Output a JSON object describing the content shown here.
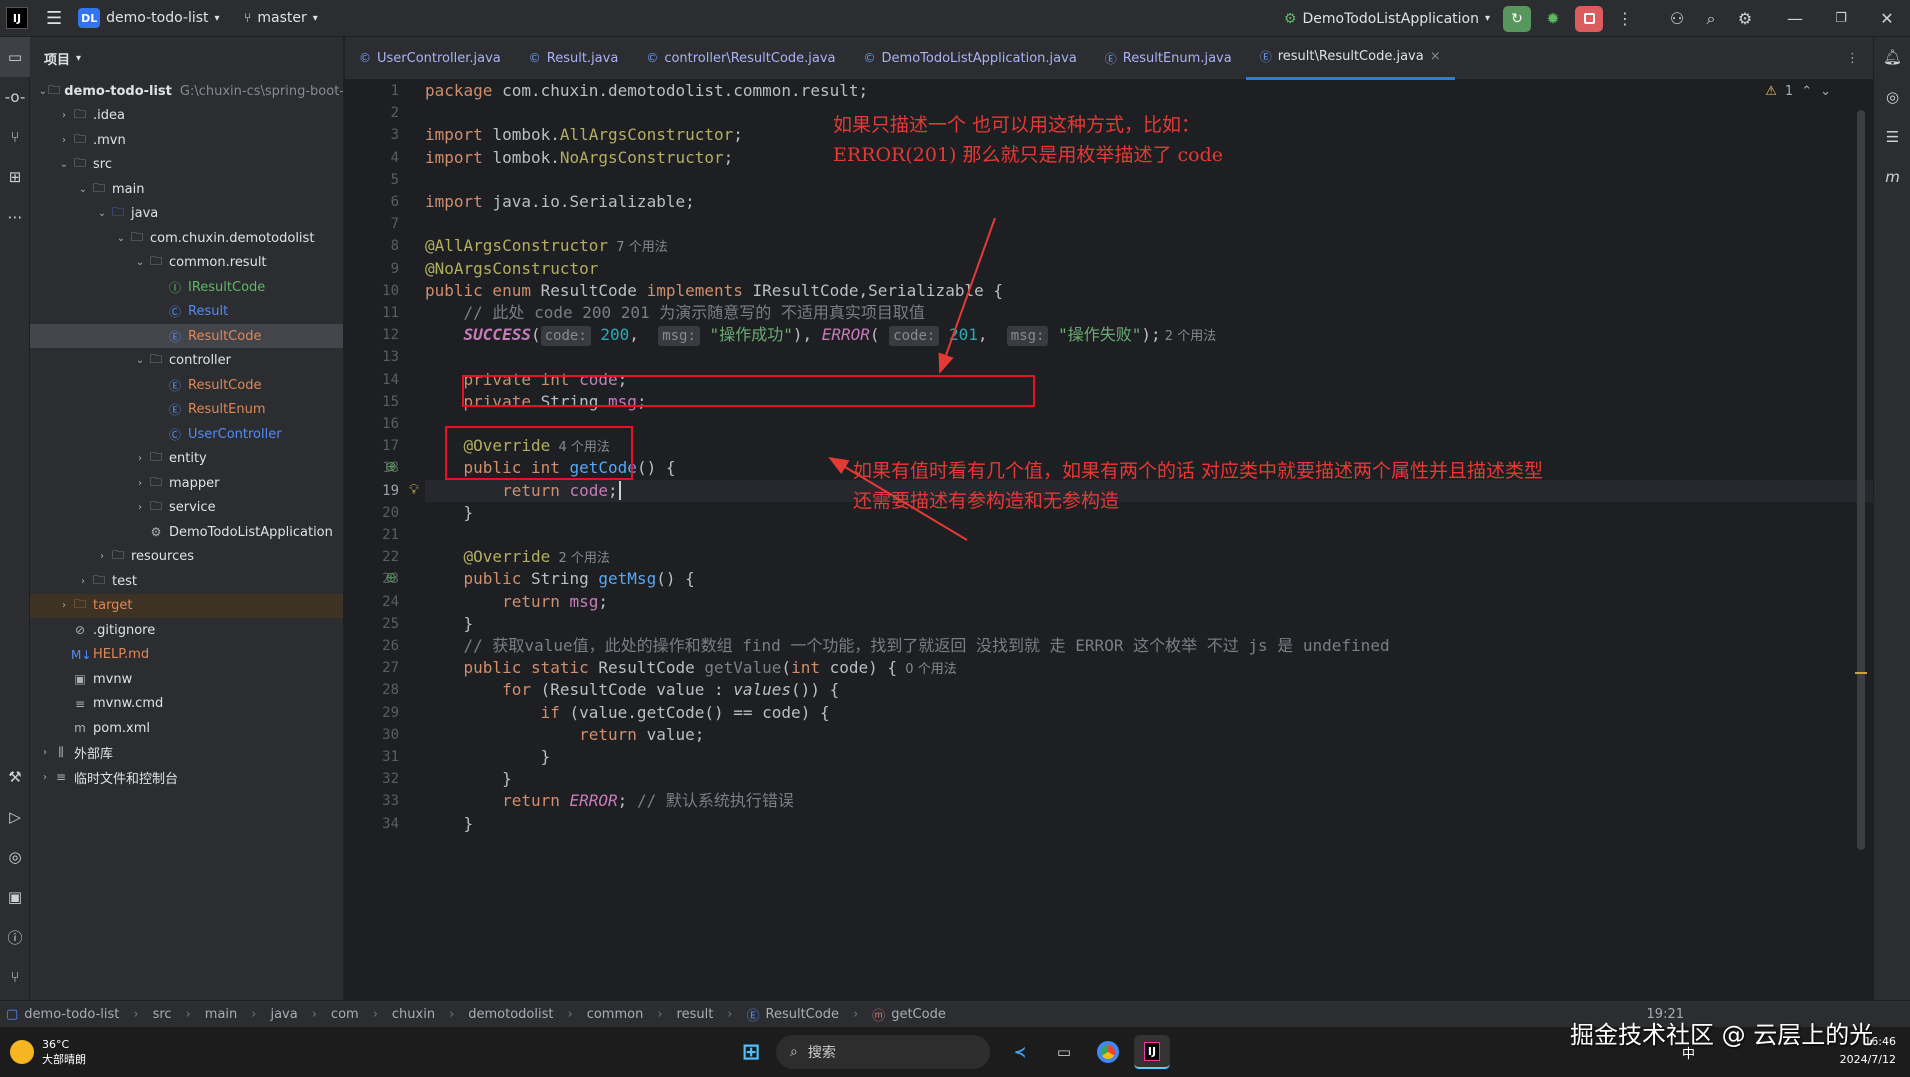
{
  "titlebar": {
    "logo": "IJ",
    "project_badge": "DL",
    "project_name": "demo-todo-list",
    "branch": "master",
    "run_config": "DemoTodoListApplication"
  },
  "project_panel": {
    "title": "项目",
    "tree": [
      {
        "label": "demo-todo-list",
        "path": "G:\\chuxin-cs\\spring-boot-",
        "indent": 0,
        "chev": "v",
        "icon": "folder",
        "bold": true
      },
      {
        "label": ".idea",
        "indent": 1,
        "chev": ">",
        "icon": "folder"
      },
      {
        "label": ".mvn",
        "indent": 1,
        "chev": ">",
        "icon": "folder"
      },
      {
        "label": "src",
        "indent": 1,
        "chev": "v",
        "icon": "folder"
      },
      {
        "label": "main",
        "indent": 2,
        "chev": "v",
        "icon": "folder"
      },
      {
        "label": "java",
        "indent": 3,
        "chev": "v",
        "icon": "folder-blue"
      },
      {
        "label": "com.chuxin.demotodolist",
        "indent": 4,
        "chev": "v",
        "icon": "package"
      },
      {
        "label": "common.result",
        "indent": 5,
        "chev": "v",
        "icon": "package"
      },
      {
        "label": "IResultCode",
        "indent": 6,
        "icon": "interface",
        "color": "green"
      },
      {
        "label": "Result",
        "indent": 6,
        "icon": "class",
        "color": "blue"
      },
      {
        "label": "ResultCode",
        "indent": 6,
        "icon": "enum",
        "color": "orange",
        "selected": true
      },
      {
        "label": "controller",
        "indent": 5,
        "chev": "v",
        "icon": "package"
      },
      {
        "label": "ResultCode",
        "indent": 6,
        "icon": "enum",
        "color": "orange"
      },
      {
        "label": "ResultEnum",
        "indent": 6,
        "icon": "enum",
        "color": "orange"
      },
      {
        "label": "UserController",
        "indent": 6,
        "icon": "class",
        "color": "blue"
      },
      {
        "label": "entity",
        "indent": 5,
        "chev": ">",
        "icon": "package"
      },
      {
        "label": "mapper",
        "indent": 5,
        "chev": ">",
        "icon": "package"
      },
      {
        "label": "service",
        "indent": 5,
        "chev": ">",
        "icon": "package"
      },
      {
        "label": "DemoTodoListApplication",
        "indent": 5,
        "icon": "spring"
      },
      {
        "label": "resources",
        "indent": 3,
        "chev": ">",
        "icon": "folder"
      },
      {
        "label": "test",
        "indent": 2,
        "chev": ">",
        "icon": "folder"
      },
      {
        "label": "target",
        "indent": 1,
        "chev": ">",
        "icon": "folder-orange",
        "color": "orange",
        "excluded": true
      },
      {
        "label": ".gitignore",
        "indent": 1,
        "icon": "ignore"
      },
      {
        "label": "HELP.md",
        "indent": 1,
        "icon": "md",
        "color": "orange"
      },
      {
        "label": "mvnw",
        "indent": 1,
        "icon": "terminal"
      },
      {
        "label": "mvnw.cmd",
        "indent": 1,
        "icon": "lines"
      },
      {
        "label": "pom.xml",
        "indent": 1,
        "icon": "maven"
      },
      {
        "label": "外部库",
        "indent": 0,
        "chev": ">",
        "icon": "library"
      },
      {
        "label": "临时文件和控制台",
        "indent": 0,
        "chev": ">",
        "icon": "scratch"
      }
    ]
  },
  "tabs": [
    {
      "label": "UserController.java",
      "icon": "©"
    },
    {
      "label": "Result.java",
      "icon": "©"
    },
    {
      "label": "controller\\ResultCode.java",
      "icon": "©"
    },
    {
      "label": "DemoTodoListApplication.java",
      "icon": "©"
    },
    {
      "label": "ResultEnum.java",
      "icon": "Ⓔ"
    },
    {
      "label": "result\\ResultCode.java",
      "icon": "Ⓔ",
      "active": true,
      "close": "×"
    }
  ],
  "editor": {
    "warning_count": "1",
    "current_line": 19,
    "lines": [
      [
        [
          "kw",
          "package "
        ],
        [
          "",
          "com.chuxin.demotodolist.common.result;"
        ]
      ],
      [],
      [
        [
          "kw",
          "import "
        ],
        [
          "",
          "lombok."
        ],
        [
          "ann",
          "AllArgsConstructor"
        ],
        [
          "",
          ";"
        ]
      ],
      [
        [
          "kw",
          "import "
        ],
        [
          "",
          "lombok."
        ],
        [
          "ann",
          "NoArgsConstructor"
        ],
        [
          "",
          ";"
        ]
      ],
      [],
      [
        [
          "kw",
          "import "
        ],
        [
          "",
          "java.io.Serializable;"
        ]
      ],
      [],
      [
        [
          "ann",
          "@AllArgsConstructor"
        ],
        [
          "usage",
          "  7 个用法"
        ]
      ],
      [
        [
          "ann",
          "@NoArgsConstructor"
        ]
      ],
      [
        [
          "kw",
          "public enum "
        ],
        [
          "",
          "ResultCode "
        ],
        [
          "kw",
          "implements "
        ],
        [
          "",
          "IResultCode,Serializable {"
        ]
      ],
      [
        [
          "",
          "    "
        ],
        [
          "cmt",
          "// 此处 code 200 201 为演示随意写的 不适用真实项目取值"
        ]
      ],
      [
        [
          "",
          "    "
        ],
        [
          "enmb",
          "SUCCESS"
        ],
        [
          "",
          "("
        ],
        [
          "hint",
          "code:"
        ],
        [
          "",
          ""
        ],
        [
          "num",
          " 200"
        ],
        [
          "",
          ",  "
        ],
        [
          "hint",
          "msg:"
        ],
        [
          "str",
          " \"操作成功\""
        ],
        [
          "",
          "), "
        ],
        [
          "enm",
          "ERROR"
        ],
        [
          "",
          "( "
        ],
        [
          "hint",
          "code:"
        ],
        [
          "num",
          " 201"
        ],
        [
          "",
          ",  "
        ],
        [
          "hint",
          "msg:"
        ],
        [
          "str",
          " \"操作失败\""
        ],
        [
          "",
          ");"
        ],
        [
          "usage",
          " 2 个用法"
        ]
      ],
      [],
      [
        [
          "",
          "    "
        ],
        [
          "kw",
          "private int "
        ],
        [
          "fld",
          "code"
        ],
        [
          "",
          ";"
        ]
      ],
      [
        [
          "",
          "    "
        ],
        [
          "kw",
          "private "
        ],
        [
          "",
          "String "
        ],
        [
          "fld",
          "msg"
        ],
        [
          "",
          ";"
        ]
      ],
      [],
      [
        [
          "",
          "    "
        ],
        [
          "ann",
          "@Override"
        ],
        [
          "usage",
          "  4 个用法"
        ]
      ],
      [
        [
          "",
          "    "
        ],
        [
          "kw",
          "public int "
        ],
        [
          "fn",
          "getCode"
        ],
        [
          "",
          "() {"
        ]
      ],
      [
        [
          "",
          "        "
        ],
        [
          "kw",
          "return "
        ],
        [
          "fld",
          "code"
        ],
        [
          "",
          ";"
        ]
      ],
      [
        [
          "",
          "    }"
        ]
      ],
      [],
      [
        [
          "",
          "    "
        ],
        [
          "ann",
          "@Override"
        ],
        [
          "usage",
          "  2 个用法"
        ]
      ],
      [
        [
          "",
          "    "
        ],
        [
          "kw",
          "public "
        ],
        [
          "",
          "String "
        ],
        [
          "fn",
          "getMsg"
        ],
        [
          "",
          "() {"
        ]
      ],
      [
        [
          "",
          "        "
        ],
        [
          "kw",
          "return "
        ],
        [
          "fld",
          "msg"
        ],
        [
          "",
          ";"
        ]
      ],
      [
        [
          "",
          "    }"
        ]
      ],
      [
        [
          "",
          "    "
        ],
        [
          "cmt",
          "// 获取value值，此处的操作和数组 find 一个功能，找到了就返回 没找到就 走 ERROR 这个枚举 不过 js 是 undefined"
        ]
      ],
      [
        [
          "",
          "    "
        ],
        [
          "kw",
          "public static "
        ],
        [
          "",
          "ResultCode "
        ],
        [
          "cmt",
          "getValue"
        ],
        [
          "",
          "("
        ],
        [
          "kw",
          "int "
        ],
        [
          "",
          "code) {"
        ],
        [
          "usage",
          "  0 个用法"
        ]
      ],
      [
        [
          "",
          "        "
        ],
        [
          "kw",
          "for "
        ],
        [
          "",
          "(ResultCode value : "
        ],
        [
          "itl",
          "values"
        ],
        [
          "",
          "()) {"
        ]
      ],
      [
        [
          "",
          "            "
        ],
        [
          "kw",
          "if "
        ],
        [
          "",
          "(value.getCode() == code) {"
        ]
      ],
      [
        [
          "",
          "                "
        ],
        [
          "kw",
          "return "
        ],
        [
          "",
          "value;"
        ]
      ],
      [
        [
          "",
          "            }"
        ]
      ],
      [
        [
          "",
          "        }"
        ]
      ],
      [
        [
          "",
          "        "
        ],
        [
          "kw",
          "return "
        ],
        [
          "enm",
          "ERROR"
        ],
        [
          "",
          "; "
        ],
        [
          "cmt",
          "// 默认系统执行错误"
        ]
      ],
      [
        [
          "",
          "    }"
        ]
      ]
    ]
  },
  "annotations": {
    "note1_line1": "如果只描述一个 也可以用这种方式，比如：",
    "note1_line2": "ERROR(201) 那么就只是用枚举描述了 code",
    "note2_line1": "如果有值时看有几个值，如果有两个的话 对应类中就要描述两个属性并且描述类型",
    "note2_line2": "还需要描述有参构造和无参构造"
  },
  "statusbar": {
    "breadcrumbs": [
      "demo-todo-list",
      "src",
      "main",
      "java",
      "com",
      "chuxin",
      "demotodolist",
      "common",
      "result",
      "ResultCode",
      "getCode"
    ],
    "position": "19:21"
  },
  "taskbar": {
    "temperature": "36°C",
    "weather": "大部晴朗",
    "search_placeholder": "搜索",
    "ime": "中",
    "time": "16:46",
    "date": "2024/7/12"
  },
  "watermark": "掘金技术社区 @ 云层上的光"
}
